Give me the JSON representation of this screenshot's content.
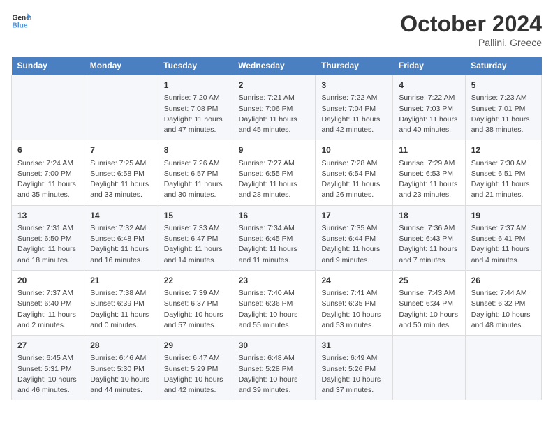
{
  "header": {
    "logo_general": "General",
    "logo_blue": "Blue",
    "month_title": "October 2024",
    "subtitle": "Pallini, Greece"
  },
  "days_of_week": [
    "Sunday",
    "Monday",
    "Tuesday",
    "Wednesday",
    "Thursday",
    "Friday",
    "Saturday"
  ],
  "weeks": [
    [
      {
        "day": "",
        "content": ""
      },
      {
        "day": "",
        "content": ""
      },
      {
        "day": "1",
        "content": "Sunrise: 7:20 AM\nSunset: 7:08 PM\nDaylight: 11 hours and 47 minutes."
      },
      {
        "day": "2",
        "content": "Sunrise: 7:21 AM\nSunset: 7:06 PM\nDaylight: 11 hours and 45 minutes."
      },
      {
        "day": "3",
        "content": "Sunrise: 7:22 AM\nSunset: 7:04 PM\nDaylight: 11 hours and 42 minutes."
      },
      {
        "day": "4",
        "content": "Sunrise: 7:22 AM\nSunset: 7:03 PM\nDaylight: 11 hours and 40 minutes."
      },
      {
        "day": "5",
        "content": "Sunrise: 7:23 AM\nSunset: 7:01 PM\nDaylight: 11 hours and 38 minutes."
      }
    ],
    [
      {
        "day": "6",
        "content": "Sunrise: 7:24 AM\nSunset: 7:00 PM\nDaylight: 11 hours and 35 minutes."
      },
      {
        "day": "7",
        "content": "Sunrise: 7:25 AM\nSunset: 6:58 PM\nDaylight: 11 hours and 33 minutes."
      },
      {
        "day": "8",
        "content": "Sunrise: 7:26 AM\nSunset: 6:57 PM\nDaylight: 11 hours and 30 minutes."
      },
      {
        "day": "9",
        "content": "Sunrise: 7:27 AM\nSunset: 6:55 PM\nDaylight: 11 hours and 28 minutes."
      },
      {
        "day": "10",
        "content": "Sunrise: 7:28 AM\nSunset: 6:54 PM\nDaylight: 11 hours and 26 minutes."
      },
      {
        "day": "11",
        "content": "Sunrise: 7:29 AM\nSunset: 6:53 PM\nDaylight: 11 hours and 23 minutes."
      },
      {
        "day": "12",
        "content": "Sunrise: 7:30 AM\nSunset: 6:51 PM\nDaylight: 11 hours and 21 minutes."
      }
    ],
    [
      {
        "day": "13",
        "content": "Sunrise: 7:31 AM\nSunset: 6:50 PM\nDaylight: 11 hours and 18 minutes."
      },
      {
        "day": "14",
        "content": "Sunrise: 7:32 AM\nSunset: 6:48 PM\nDaylight: 11 hours and 16 minutes."
      },
      {
        "day": "15",
        "content": "Sunrise: 7:33 AM\nSunset: 6:47 PM\nDaylight: 11 hours and 14 minutes."
      },
      {
        "day": "16",
        "content": "Sunrise: 7:34 AM\nSunset: 6:45 PM\nDaylight: 11 hours and 11 minutes."
      },
      {
        "day": "17",
        "content": "Sunrise: 7:35 AM\nSunset: 6:44 PM\nDaylight: 11 hours and 9 minutes."
      },
      {
        "day": "18",
        "content": "Sunrise: 7:36 AM\nSunset: 6:43 PM\nDaylight: 11 hours and 7 minutes."
      },
      {
        "day": "19",
        "content": "Sunrise: 7:37 AM\nSunset: 6:41 PM\nDaylight: 11 hours and 4 minutes."
      }
    ],
    [
      {
        "day": "20",
        "content": "Sunrise: 7:37 AM\nSunset: 6:40 PM\nDaylight: 11 hours and 2 minutes."
      },
      {
        "day": "21",
        "content": "Sunrise: 7:38 AM\nSunset: 6:39 PM\nDaylight: 11 hours and 0 minutes."
      },
      {
        "day": "22",
        "content": "Sunrise: 7:39 AM\nSunset: 6:37 PM\nDaylight: 10 hours and 57 minutes."
      },
      {
        "day": "23",
        "content": "Sunrise: 7:40 AM\nSunset: 6:36 PM\nDaylight: 10 hours and 55 minutes."
      },
      {
        "day": "24",
        "content": "Sunrise: 7:41 AM\nSunset: 6:35 PM\nDaylight: 10 hours and 53 minutes."
      },
      {
        "day": "25",
        "content": "Sunrise: 7:43 AM\nSunset: 6:34 PM\nDaylight: 10 hours and 50 minutes."
      },
      {
        "day": "26",
        "content": "Sunrise: 7:44 AM\nSunset: 6:32 PM\nDaylight: 10 hours and 48 minutes."
      }
    ],
    [
      {
        "day": "27",
        "content": "Sunrise: 6:45 AM\nSunset: 5:31 PM\nDaylight: 10 hours and 46 minutes."
      },
      {
        "day": "28",
        "content": "Sunrise: 6:46 AM\nSunset: 5:30 PM\nDaylight: 10 hours and 44 minutes."
      },
      {
        "day": "29",
        "content": "Sunrise: 6:47 AM\nSunset: 5:29 PM\nDaylight: 10 hours and 42 minutes."
      },
      {
        "day": "30",
        "content": "Sunrise: 6:48 AM\nSunset: 5:28 PM\nDaylight: 10 hours and 39 minutes."
      },
      {
        "day": "31",
        "content": "Sunrise: 6:49 AM\nSunset: 5:26 PM\nDaylight: 10 hours and 37 minutes."
      },
      {
        "day": "",
        "content": ""
      },
      {
        "day": "",
        "content": ""
      }
    ]
  ]
}
